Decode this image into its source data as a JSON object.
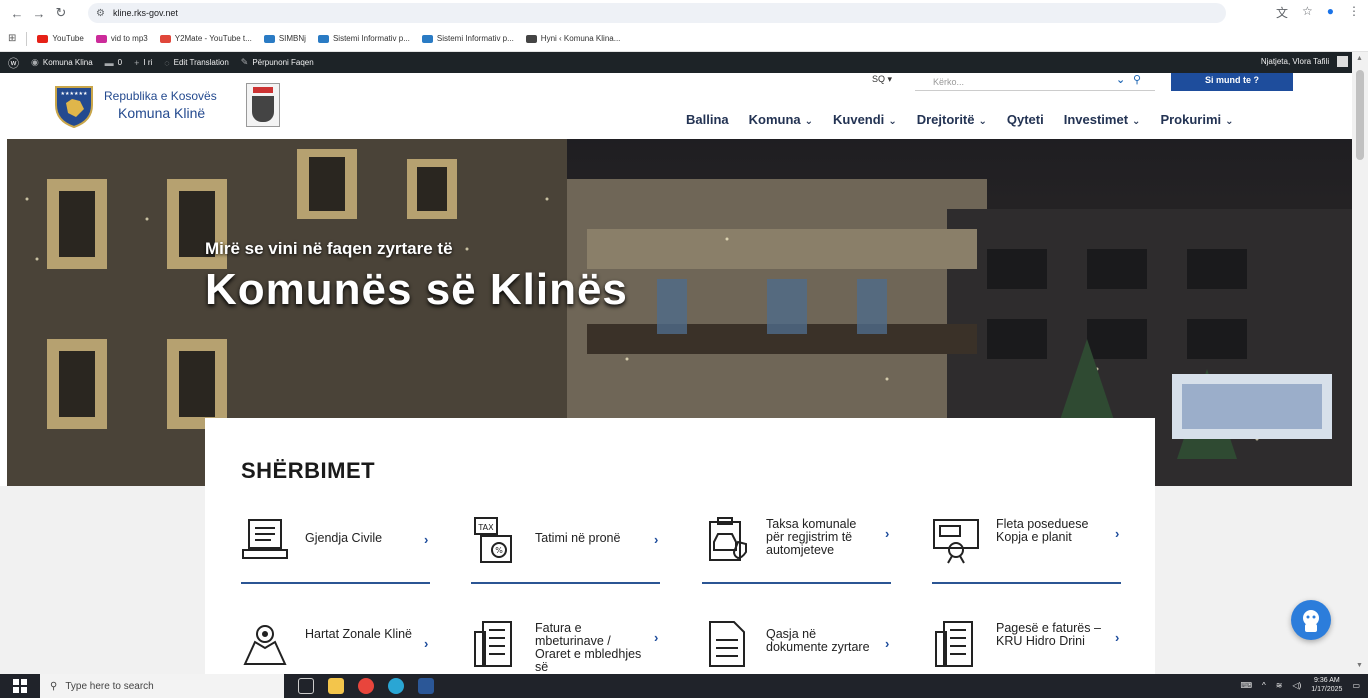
{
  "browser": {
    "url": "kline.rks-gov.net",
    "bookmarks": [
      {
        "label": "YouTube",
        "color": "#e62117"
      },
      {
        "label": "vid to mp3",
        "color": "#cc2b9a"
      },
      {
        "label": "Y2Mate - YouTube t...",
        "color": "#e0463a"
      },
      {
        "label": "SIMBNj",
        "color": "#2a7bc4"
      },
      {
        "label": "Sistemi Informativ p...",
        "color": "#2a7bc4"
      },
      {
        "label": "Sistemi Informativ p...",
        "color": "#2a7bc4"
      },
      {
        "label": "Hyni ‹ Komuna Klina...",
        "color": "#444444"
      }
    ]
  },
  "adminbar": {
    "site_name": "Komuna Klina",
    "comments": "0",
    "new": "I ri",
    "edit_translation": "Edit Translation",
    "edit_page": "Përpunoni Faqen",
    "greeting": "Njatjeta, Vlora Tafili"
  },
  "header": {
    "logo_line1": "Republika e Kosovës",
    "logo_line2": "Komuna Klinë",
    "language": "SQ ▾",
    "search_placeholder": "Kërko...",
    "cta": "Si mund te ?",
    "nav": [
      {
        "label": "Ballina",
        "dropdown": false
      },
      {
        "label": "Komuna",
        "dropdown": true
      },
      {
        "label": "Kuvendi",
        "dropdown": true
      },
      {
        "label": "Drejtoritë",
        "dropdown": true
      },
      {
        "label": "Qyteti",
        "dropdown": false
      },
      {
        "label": "Investimet",
        "dropdown": true
      },
      {
        "label": "Prokurimi",
        "dropdown": true
      }
    ]
  },
  "hero": {
    "subtitle": "Mirë se vini në faqen zyrtare të",
    "title": "Komunës së Klinës"
  },
  "services": {
    "title": "SHËRBIMET",
    "items": [
      {
        "label": "Gjendja Civile",
        "icon": "laptop-document-icon"
      },
      {
        "label": "Tatimi në pronë",
        "icon": "tax-document-icon"
      },
      {
        "label": "Taksa komunale për regjistrim të automjeteve",
        "icon": "car-clipboard-icon"
      },
      {
        "label": "Fleta poseduese Kopja e planit",
        "icon": "certificate-icon"
      },
      {
        "label": "Hartat Zonale Klinë",
        "icon": "map-pin-icon"
      },
      {
        "label": "Fatura e mbeturinave / Oraret e mbledhjes së",
        "icon": "invoice-icon"
      },
      {
        "label": "Qasja në dokumente zyrtare",
        "icon": "document-icon"
      },
      {
        "label": "Pagesë e faturës – KRU Hidro Drini",
        "icon": "invoice-icon"
      }
    ]
  },
  "taskbar": {
    "search_placeholder": "Type here to search",
    "time": "9:36 AM",
    "date": "1/17/2025"
  }
}
